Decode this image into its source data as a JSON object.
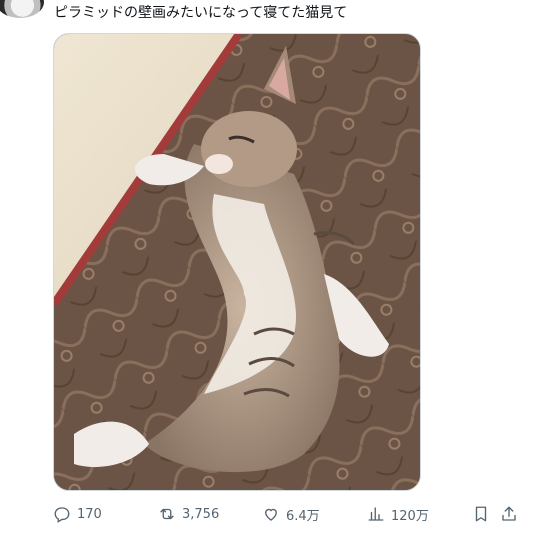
{
  "post": {
    "text": "ピラミッドの壁画みたいになって寝てた猫見て"
  },
  "actions": {
    "replies": "170",
    "reposts": "3,756",
    "likes": "6.4万",
    "views": "120万"
  },
  "icons": [
    "avatar",
    "reply-icon",
    "repost-icon",
    "like-icon",
    "views-icon",
    "bookmark-icon",
    "share-icon"
  ],
  "colors": {
    "text": "#0f1419",
    "muted": "#536471",
    "border": "#cfd9de"
  }
}
